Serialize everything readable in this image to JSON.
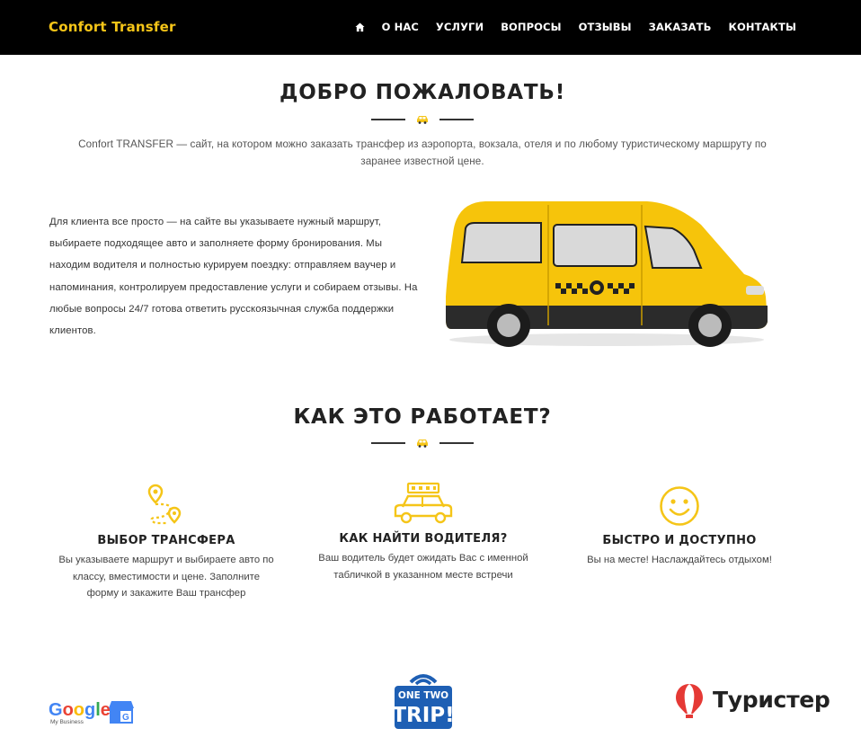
{
  "brand": "Confort Transfer",
  "colors": {
    "accent": "#f5c518",
    "nav_bg": "#000000",
    "heading": "#222222"
  },
  "nav": {
    "home_icon": "home-icon",
    "items": [
      "О НАС",
      "УСЛУГИ",
      "ВОПРОСЫ",
      "ОТЗЫВЫ",
      "ЗАКАЗАТЬ",
      "КОНТАКТЫ"
    ]
  },
  "welcome": {
    "title": "ДОБРО ПОЖАЛОВАТЬ!",
    "intro": "Confort TRANSFER — сайт, на котором можно заказать трансфер из аэропорта, вокзала, отеля и по любому туристическому маршруту по заранее известной цене.",
    "body": "Для клиента все просто — на сайте вы указываете нужный маршрут, выбираете подходящее авто и заполняете форму бронирования. Мы находим водителя и полностью курируем поездку: отправляем ваучер и напоминания, контролируем предоставление услуги и собираем отзывы. На любые вопросы 24/7 готова ответить русскоязычная служба поддержки клиентов."
  },
  "how": {
    "title": "КАК ЭТО РАБОТАЕТ?",
    "features": [
      {
        "icon": "route-pin-icon",
        "title": "ВЫБОР ТРАНСФЕРА",
        "text": "Вы указываете маршрут и выбираете авто по классу, вместимости и цене. Заполните форму и закажите Ваш трансфер"
      },
      {
        "icon": "taxi-icon",
        "title": "КАК НАЙТИ ВОДИТЕЛЯ?",
        "text": "Ваш водитель будет ожидать Вас с именной табличкой в указанном месте встречи"
      },
      {
        "icon": "smiley-icon",
        "title": "БЫСТРО И ДОСТУПНО",
        "text": "Вы на месте! Наслаждайтесь отдыхом!"
      }
    ]
  },
  "partners": {
    "google": {
      "name": "Google",
      "sub": "My Business"
    },
    "onetwotrip": {
      "line1": "ONE TWO",
      "line2": "TRIP!"
    },
    "turister": "Туристер"
  }
}
